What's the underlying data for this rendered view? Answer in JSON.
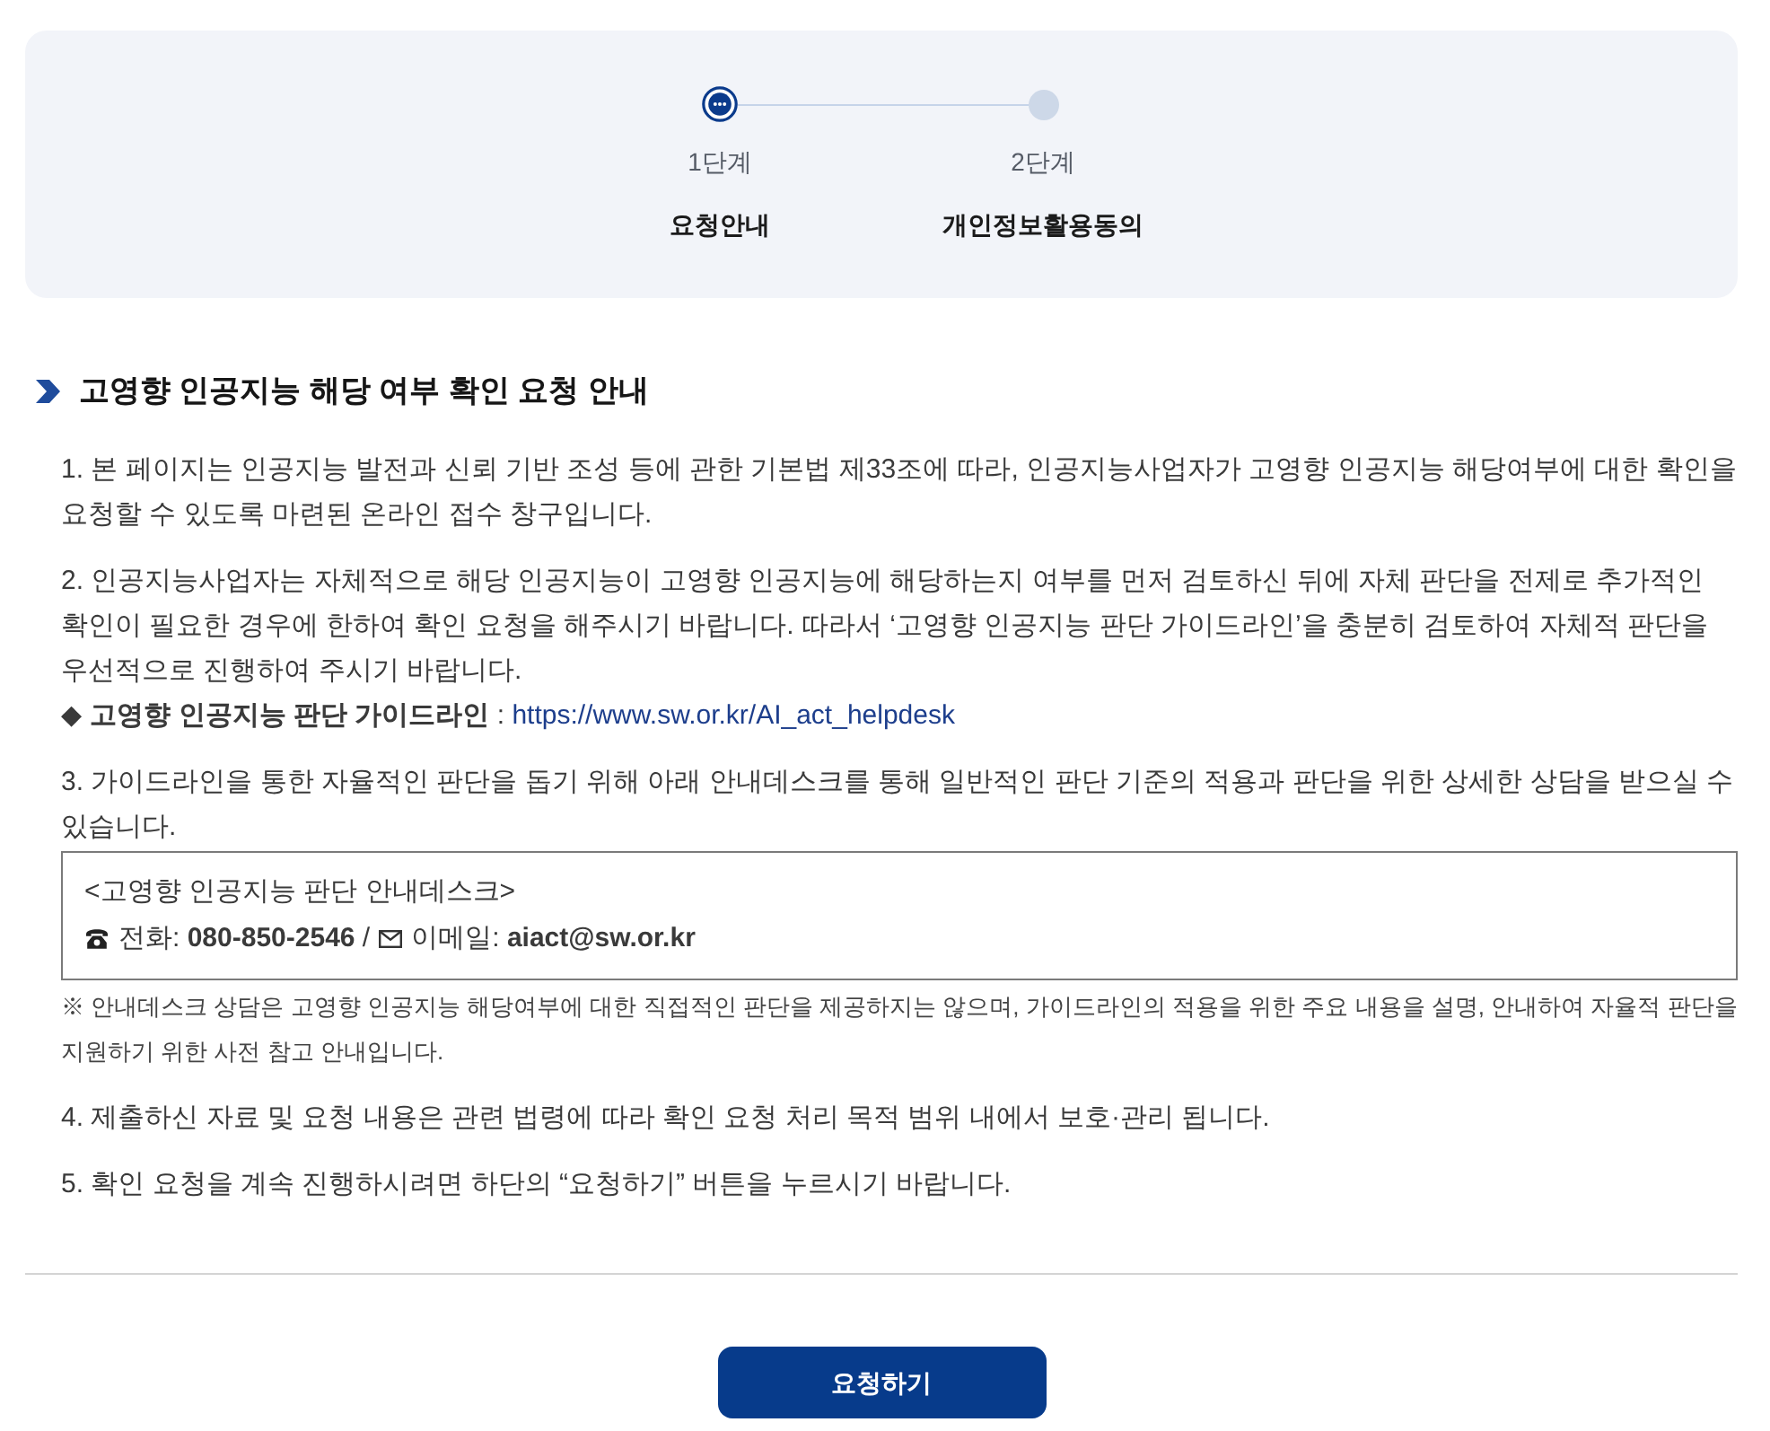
{
  "stepper": {
    "steps": [
      {
        "number": "1단계",
        "label": "요청안내",
        "selected": true
      },
      {
        "number": "2단계",
        "label": "개인정보활용동의",
        "selected": false
      }
    ]
  },
  "notice": {
    "title": "고영향 인공지능 해당 여부 확인 요청 안내",
    "items": [
      {
        "text": "1. 본 페이지는 인공지능 발전과 신뢰 기반 조성 등에 관한 기본법 제33조에 따라, 인공지능사업자가 고영향 인공지능 해당여부에 대한 확인을 요청할 수 있도록 마련된 온라인 접수 창구입니다."
      },
      {
        "text": "2. 인공지능사업자는 자체적으로 해당 인공지능이 고영향 인공지능에 해당하는지 여부를 먼저 검토하신 뒤에 자체 판단을 전제로 추가적인 확인이 필요한 경우에 한하여 확인 요청을 해주시기 바랍니다. 따라서 ‘고영향 인공지능 판단 가이드라인’을 충분히 검토하여 자체적 판단을 우선적으로 진행하여 주시기 바랍니다.",
        "guideline": {
          "label": "◆ **고영향 인공지능 판단 가이드라인** :",
          "url": "https://www.sw.or.kr/AI_act_helpdesk"
        }
      },
      {
        "text": "3. 가이드라인을 통한 자율적인 판단을 돕기 위해 아래 안내데스크를 통해 일반적인 판단 기준의 적용과 판단을 위한 상세한 상담을 받으실 수 있습니다.",
        "helpdesk": {
          "title": "<고영향 인공지능 판단 안내데스크>",
          "phone": "전화: **080-850-2546** /",
          "email": "이메일: **aiact@sw.or.kr**"
        },
        "note": "※ 안내데스크 상담은 고영향 인공지능 해당여부에 대한 직접적인 판단을 제공하지는 않으며, 가이드라인의 적용을 위한 주요 내용을 설명, 안내하여 자율적 판단을 지원하기 위한 사전 참고 안내입니다."
      },
      {
        "text": "4. 제출하신 자료 및 요청 내용은 관련 법령에 따라 확인 요청 처리 목적 범위 내에서 보호·관리 됩니다."
      },
      {
        "text": "5. 확인 요청을 계속 진행하시려면 하단의 “요청하기” 버튼을 누르시기 바랍니다."
      }
    ]
  },
  "submit_button": "요청하기"
}
